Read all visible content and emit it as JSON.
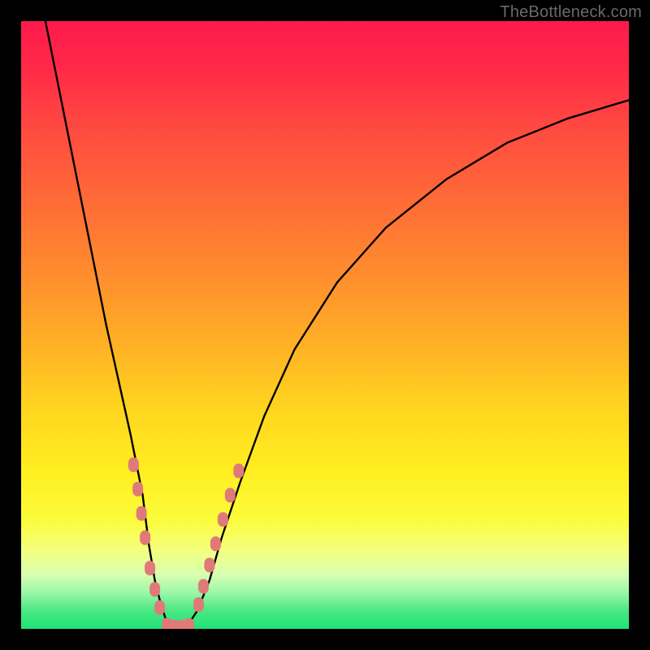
{
  "watermark": "TheBottleneck.com",
  "chart_data": {
    "type": "line",
    "title": "",
    "xlabel": "",
    "ylabel": "",
    "xlim": [
      0,
      100
    ],
    "ylim": [
      0,
      100
    ],
    "grid": false,
    "background_gradient": {
      "top": "#ff1a4c",
      "upper_mid": "#ff8e2e",
      "mid": "#ffee20",
      "lower_mid": "#d9ffb0",
      "bottom": "#1ee277"
    },
    "series": [
      {
        "name": "bottleneck-curve",
        "color": "#000000",
        "x": [
          4,
          6,
          8,
          10,
          12,
          14,
          16,
          18,
          20,
          21,
          22,
          23,
          24,
          25,
          27,
          29,
          31,
          33,
          36,
          40,
          45,
          52,
          60,
          70,
          80,
          90,
          100
        ],
        "values": [
          100,
          90,
          80,
          70,
          60,
          50,
          41,
          32,
          22,
          14,
          8,
          4,
          1,
          0,
          0,
          3,
          8,
          15,
          24,
          35,
          46,
          57,
          66,
          74,
          80,
          84,
          87
        ]
      }
    ],
    "markers": [
      {
        "name": "left-cluster",
        "color": "#e07a78",
        "shape": "rounded",
        "points": [
          {
            "x": 18.5,
            "y": 27
          },
          {
            "x": 19.2,
            "y": 23
          },
          {
            "x": 19.8,
            "y": 19
          },
          {
            "x": 20.4,
            "y": 15
          },
          {
            "x": 21.2,
            "y": 10
          },
          {
            "x": 22.0,
            "y": 6.5
          },
          {
            "x": 22.8,
            "y": 3.5
          }
        ]
      },
      {
        "name": "bottom-cluster",
        "color": "#e07a78",
        "shape": "rounded",
        "points": [
          {
            "x": 24.0,
            "y": 0.6
          },
          {
            "x": 25.2,
            "y": 0.3
          },
          {
            "x": 26.4,
            "y": 0.3
          },
          {
            "x": 27.6,
            "y": 0.6
          }
        ]
      },
      {
        "name": "right-cluster",
        "color": "#e07a78",
        "shape": "rounded",
        "points": [
          {
            "x": 29.2,
            "y": 4
          },
          {
            "x": 30.0,
            "y": 7
          },
          {
            "x": 31.0,
            "y": 10.5
          },
          {
            "x": 32.0,
            "y": 14
          },
          {
            "x": 33.2,
            "y": 18
          },
          {
            "x": 34.4,
            "y": 22
          },
          {
            "x": 35.8,
            "y": 26
          }
        ]
      }
    ]
  }
}
